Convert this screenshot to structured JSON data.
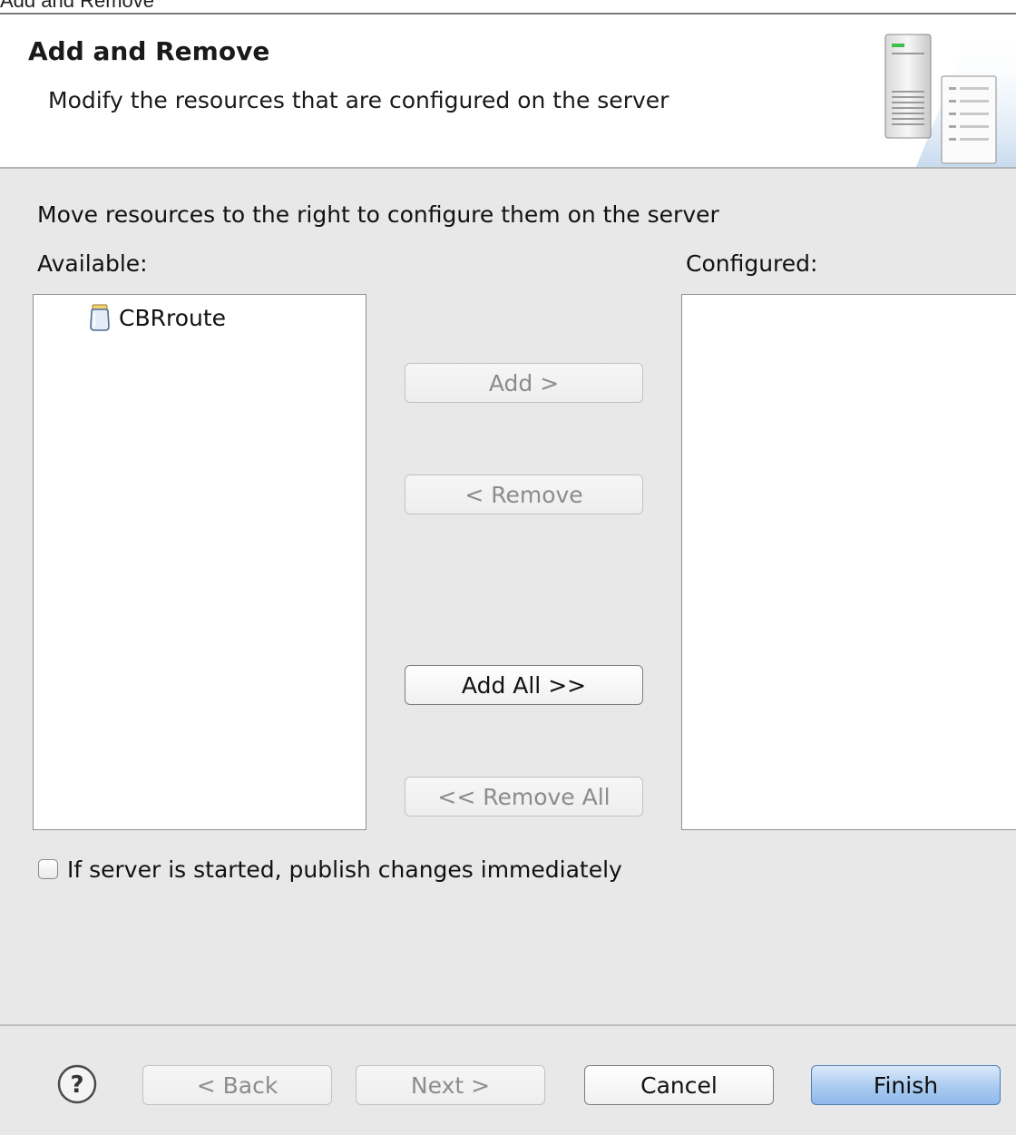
{
  "window": {
    "title": "Add and Remove"
  },
  "header": {
    "title": "Add and Remove",
    "description": "Modify the resources that are configured on the server"
  },
  "content": {
    "instruction": "Move resources to the right to configure them on the server",
    "available_label": "Available:",
    "configured_label": "Configured:",
    "available_items": [
      {
        "label": "CBRroute",
        "icon": "jar-icon"
      }
    ],
    "configured_items": [],
    "buttons": {
      "add": {
        "label": "Add >",
        "enabled": false
      },
      "remove": {
        "label": "< Remove",
        "enabled": false
      },
      "add_all": {
        "label": "Add All >>",
        "enabled": true
      },
      "remove_all": {
        "label": "<< Remove All",
        "enabled": false
      }
    },
    "publish_checkbox": {
      "label": "If server is started, publish changes immediately",
      "checked": false
    }
  },
  "footer": {
    "help_icon": "help-icon",
    "back_label": "< Back",
    "next_label": "Next >",
    "cancel_label": "Cancel",
    "finish_label": "Finish"
  },
  "colors": {
    "background": "#e8e8e8",
    "header_background": "#ffffff",
    "default_button": "#a9cbf0"
  }
}
